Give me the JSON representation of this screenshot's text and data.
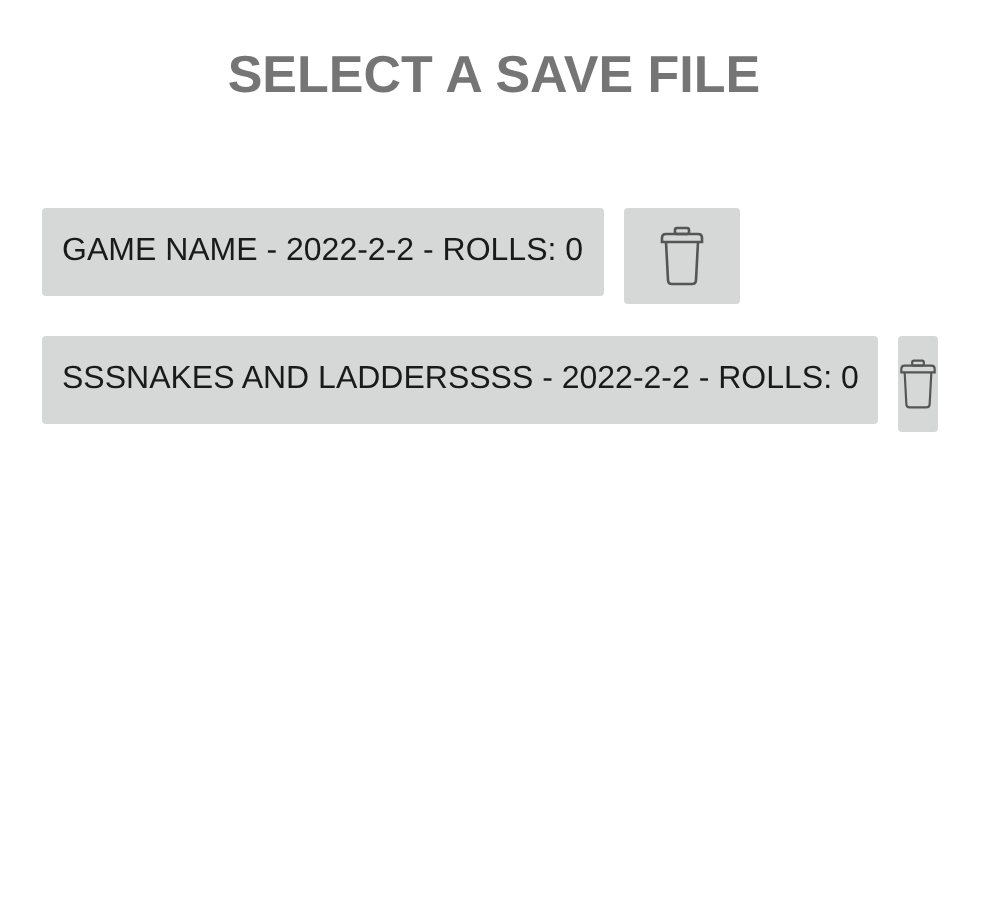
{
  "title": "SELECT A SAVE FILE",
  "saves": [
    {
      "label": "GAME NAME - 2022-2-2 - ROLLS: 0",
      "kind": "wide"
    },
    {
      "label": "SSSNAKES AND LADDERSSSS - 2022-2-2 - ROLLS: 0",
      "kind": "narrow"
    }
  ]
}
